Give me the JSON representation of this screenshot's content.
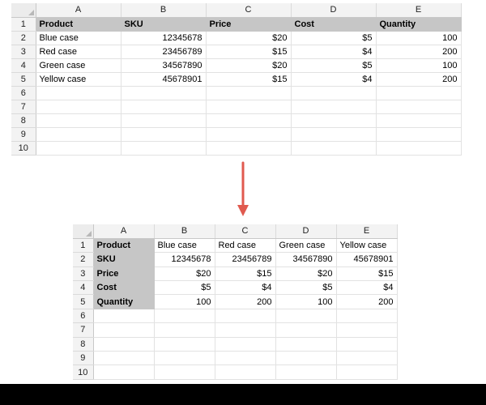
{
  "before": {
    "columns": [
      "A",
      "B",
      "C",
      "D",
      "E"
    ],
    "rows": [
      {
        "n": "1",
        "cells": [
          "Product",
          "SKU",
          "Price",
          "Cost",
          "Quantity"
        ]
      },
      {
        "n": "2",
        "cells": [
          "Blue case",
          "12345678",
          "$20",
          "$5",
          "100"
        ]
      },
      {
        "n": "3",
        "cells": [
          "Red case",
          "23456789",
          "$15",
          "$4",
          "200"
        ]
      },
      {
        "n": "4",
        "cells": [
          "Green case",
          "34567890",
          "$20",
          "$5",
          "100"
        ]
      },
      {
        "n": "5",
        "cells": [
          "Yellow case",
          "45678901",
          "$15",
          "$4",
          "200"
        ]
      },
      {
        "n": "6",
        "cells": [
          "",
          "",
          "",
          "",
          ""
        ]
      },
      {
        "n": "7",
        "cells": [
          "",
          "",
          "",
          "",
          ""
        ]
      },
      {
        "n": "8",
        "cells": [
          "",
          "",
          "",
          "",
          ""
        ]
      },
      {
        "n": "9",
        "cells": [
          "",
          "",
          "",
          "",
          ""
        ]
      },
      {
        "n": "10",
        "cells": [
          "",
          "",
          "",
          "",
          ""
        ]
      }
    ]
  },
  "after": {
    "columns": [
      "A",
      "B",
      "C",
      "D",
      "E"
    ],
    "rows": [
      {
        "n": "1",
        "cells": [
          "Product",
          "Blue case",
          "Red case",
          "Green case",
          "Yellow case"
        ]
      },
      {
        "n": "2",
        "cells": [
          "SKU",
          "12345678",
          "23456789",
          "34567890",
          "45678901"
        ]
      },
      {
        "n": "3",
        "cells": [
          "Price",
          "$20",
          "$15",
          "$20",
          "$15"
        ]
      },
      {
        "n": "4",
        "cells": [
          "Cost",
          "$5",
          "$4",
          "$5",
          "$4"
        ]
      },
      {
        "n": "5",
        "cells": [
          "Quantity",
          "100",
          "200",
          "100",
          "200"
        ]
      },
      {
        "n": "6",
        "cells": [
          "",
          "",
          "",
          "",
          ""
        ]
      },
      {
        "n": "7",
        "cells": [
          "",
          "",
          "",
          "",
          ""
        ]
      },
      {
        "n": "8",
        "cells": [
          "",
          "",
          "",
          "",
          ""
        ]
      },
      {
        "n": "9",
        "cells": [
          "",
          "",
          "",
          "",
          ""
        ]
      },
      {
        "n": "10",
        "cells": [
          "",
          "",
          "",
          "",
          ""
        ]
      }
    ]
  },
  "colors": {
    "header_fill": "#c6c6c6",
    "arrow": "#e05a4f"
  },
  "icons": {
    "arrow": "down-arrow-icon"
  }
}
